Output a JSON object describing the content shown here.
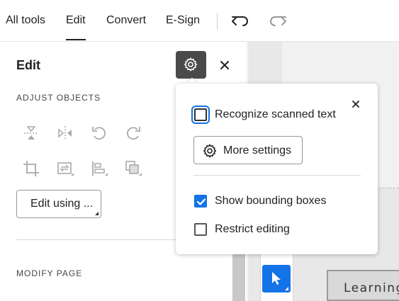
{
  "topbar": {
    "tabs": [
      {
        "label": "All tools",
        "active": false
      },
      {
        "label": "Edit",
        "active": true
      },
      {
        "label": "Convert",
        "active": false
      },
      {
        "label": "E-Sign",
        "active": false
      }
    ],
    "undo_icon": "undo-icon",
    "redo_icon": "redo-icon"
  },
  "panel": {
    "title": "Edit",
    "settings_icon": "gear-icon",
    "close_icon": "close-icon",
    "adjust_objects_label": "ADJUST OBJECTS",
    "object_tools": [
      "flip-vertical-icon",
      "flip-horizontal-icon",
      "rotate-left-icon",
      "rotate-right-icon",
      "crop-icon",
      "replace-image-icon",
      "align-objects-icon",
      "arrange-objects-icon"
    ],
    "edit_using_label": "Edit using ...",
    "modify_page_label": "MODIFY PAGE"
  },
  "popover": {
    "close_icon": "close-icon",
    "recognize_scanned_text": {
      "label": "Recognize scanned text",
      "checked": false
    },
    "more_settings_label": "More settings",
    "show_bounding_boxes": {
      "label": "Show bounding boxes",
      "checked": true
    },
    "restrict_editing": {
      "label": "Restrict editing",
      "checked": false
    }
  },
  "canvas": {
    "select_tool_icon": "cursor-icon",
    "page_text": "Learning"
  },
  "colors": {
    "accent": "#1473e6",
    "gear_button_bg": "#4a4a4a"
  }
}
